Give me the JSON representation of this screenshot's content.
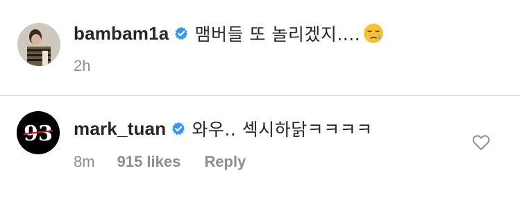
{
  "caption": {
    "username": "bambam1a",
    "text": "맴버들 또 놀리겠지....",
    "emoji": "sleepy-face-emoji",
    "time": "2h"
  },
  "comment": {
    "username": "mark_tuan",
    "avatar_text": "93",
    "text": "와우.. 섹시하닭ㅋㅋㅋㅋ",
    "time": "8m",
    "likes": "915 likes",
    "reply_label": "Reply"
  },
  "icons": {
    "verified": "verified-badge-icon",
    "like": "heart-outline-icon"
  },
  "colors": {
    "text": "#262626",
    "muted": "#8e8e8e",
    "verified": "#3897f0",
    "divider": "#dbdbdb"
  }
}
